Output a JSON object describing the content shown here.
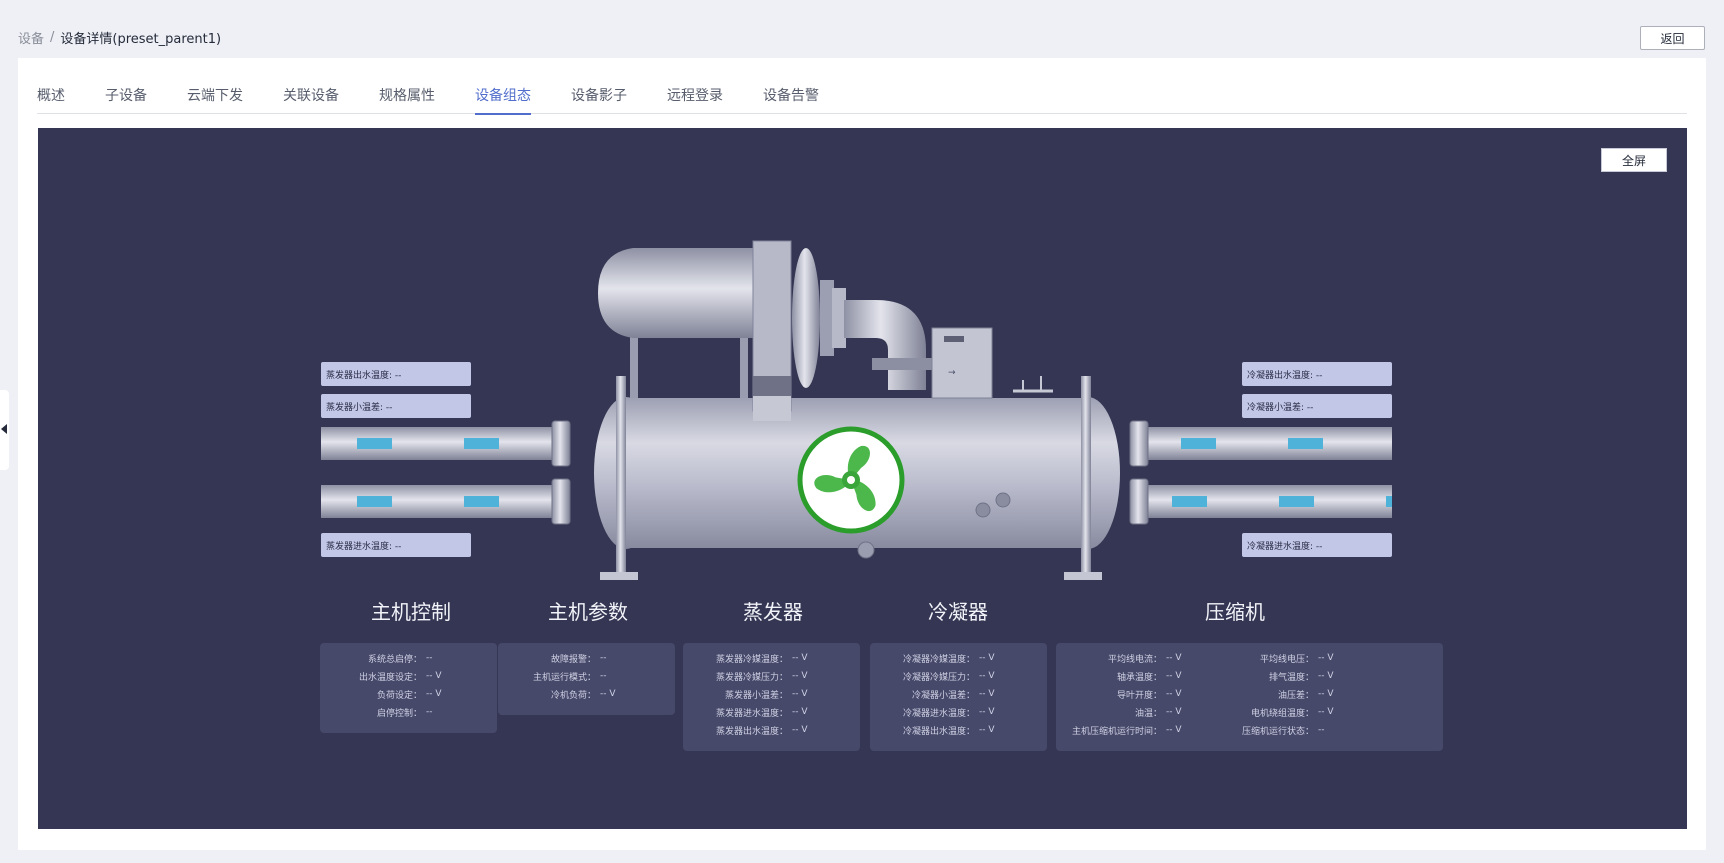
{
  "breadcrumb": {
    "root": "设备",
    "separator": "/",
    "current": "设备详情(preset_parent1)"
  },
  "back_label": "返回",
  "tabs": [
    "概述",
    "子设备",
    "云端下发",
    "关联设备",
    "规格属性",
    "设备组态",
    "设备影子",
    "远程登录",
    "设备告警"
  ],
  "active_tab": "设备组态",
  "fullscreen_label": "全屏",
  "sensors": {
    "evap_out": "蒸发器出水温度: --",
    "evap_small": "蒸发器小温差: --",
    "evap_in": "蒸发器进水温度: --",
    "cond_out": "冷凝器出水温度: --",
    "cond_small": "冷凝器小温差: --",
    "cond_in": "冷凝器进水温度: --"
  },
  "panels": {
    "host_control": {
      "title": "主机控制",
      "rows": [
        {
          "label": "系统总启停：",
          "value": "--"
        },
        {
          "label": "出水温度设定：",
          "value": "-- V"
        },
        {
          "label": "负荷设定：",
          "value": "-- V"
        },
        {
          "label": "启停控制：",
          "value": "--"
        }
      ]
    },
    "host_params": {
      "title": "主机参数",
      "rows": [
        {
          "label": "故障报警：",
          "value": "--"
        },
        {
          "label": "主机运行模式：",
          "value": "--"
        },
        {
          "label": "冷机负荷：",
          "value": "-- V"
        }
      ]
    },
    "evaporator": {
      "title": "蒸发器",
      "rows": [
        {
          "label": "蒸发器冷媒温度：",
          "value": "-- V"
        },
        {
          "label": "蒸发器冷媒压力：",
          "value": "-- V"
        },
        {
          "label": "蒸发器小温差：",
          "value": "-- V"
        },
        {
          "label": "蒸发器进水温度：",
          "value": "-- V"
        },
        {
          "label": "蒸发器出水温度：",
          "value": "-- V"
        }
      ]
    },
    "condenser": {
      "title": "冷凝器",
      "rows": [
        {
          "label": "冷凝器冷媒温度：",
          "value": "-- V"
        },
        {
          "label": "冷凝器冷媒压力：",
          "value": "-- V"
        },
        {
          "label": "冷凝器小温差：",
          "value": "-- V"
        },
        {
          "label": "冷凝器进水温度：",
          "value": "-- V"
        },
        {
          "label": "冷凝器出水温度：",
          "value": "-- V"
        }
      ]
    },
    "compressor": {
      "title": "压缩机",
      "left_rows": [
        {
          "label": "平均线电流：",
          "value": "-- V"
        },
        {
          "label": "轴承温度：",
          "value": "-- V"
        },
        {
          "label": "导叶开度：",
          "value": "-- V"
        },
        {
          "label": "油温：",
          "value": "-- V"
        },
        {
          "label": "主机压缩机运行时间：",
          "value": "-- V"
        }
      ],
      "right_rows": [
        {
          "label": "平均线电压：",
          "value": "-- V"
        },
        {
          "label": "排气温度：",
          "value": "-- V"
        },
        {
          "label": "油压差：",
          "value": "-- V"
        },
        {
          "label": "电机绕组温度：",
          "value": "-- V"
        },
        {
          "label": "压缩机运行状态：",
          "value": "--"
        }
      ]
    }
  },
  "colors": {
    "accent": "#526ecc",
    "canvas_bg": "#343653",
    "fan_green": "#2a9d2a",
    "pipe_marker": "#4fb3d9"
  }
}
